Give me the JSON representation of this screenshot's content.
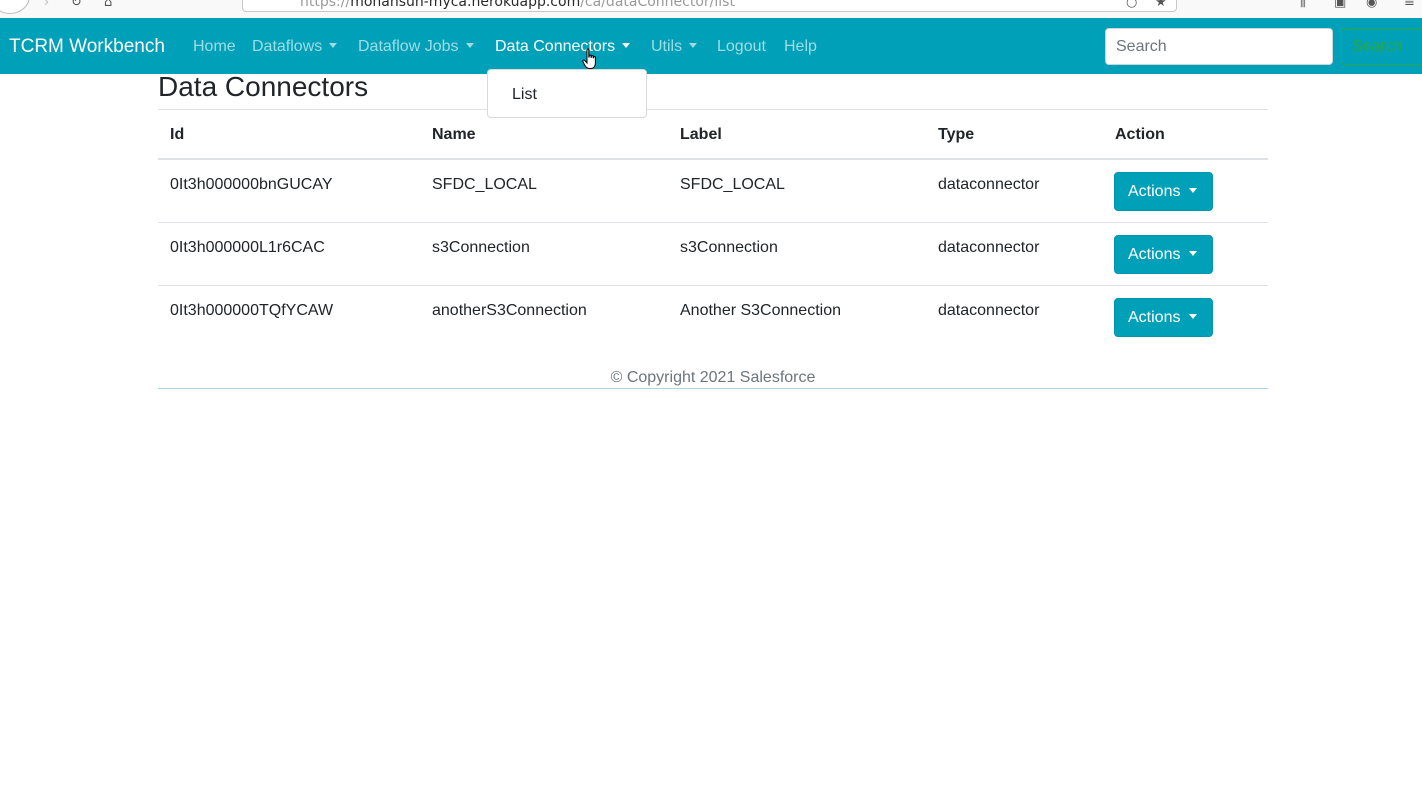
{
  "browser": {
    "url_prefix": "https://",
    "url_host": "mohansun-myca.herokuapp.com",
    "url_path": "/ca/dataConnector/list"
  },
  "navbar": {
    "brand": "TCRM Workbench",
    "items": [
      {
        "label": "Home",
        "has_caret": false,
        "active": false
      },
      {
        "label": "Dataflows",
        "has_caret": true,
        "active": false
      },
      {
        "label": "Dataflow Jobs",
        "has_caret": true,
        "active": false
      },
      {
        "label": "Data Connectors",
        "has_caret": true,
        "active": true
      },
      {
        "label": "Utils",
        "has_caret": true,
        "active": false
      },
      {
        "label": "Logout",
        "has_caret": false,
        "active": false
      },
      {
        "label": "Help",
        "has_caret": false,
        "active": false
      }
    ],
    "search_placeholder": "Search",
    "search_button": "Search"
  },
  "dropdown": {
    "items": [
      "List"
    ]
  },
  "page": {
    "title": "Data Connectors"
  },
  "table": {
    "headers": [
      "Id",
      "Name",
      "Label",
      "Type",
      "Action"
    ],
    "rows": [
      {
        "id": "0It3h000000bnGUCAY",
        "name": "SFDC_LOCAL",
        "label": "SFDC_LOCAL",
        "type": "dataconnector",
        "action": "Actions"
      },
      {
        "id": "0It3h000000L1r6CAC",
        "name": "s3Connection",
        "label": "s3Connection",
        "type": "dataconnector",
        "action": "Actions"
      },
      {
        "id": "0It3h000000TQfYCAW",
        "name": "anotherS3Connection",
        "label": "Another S3Connection",
        "type": "dataconnector",
        "action": "Actions"
      }
    ]
  },
  "footer": {
    "text": "© Copyright 2021 Salesforce"
  },
  "colors": {
    "navbar": "#00a1b8",
    "button": "#00a1b8",
    "search_button": "#28a745"
  }
}
